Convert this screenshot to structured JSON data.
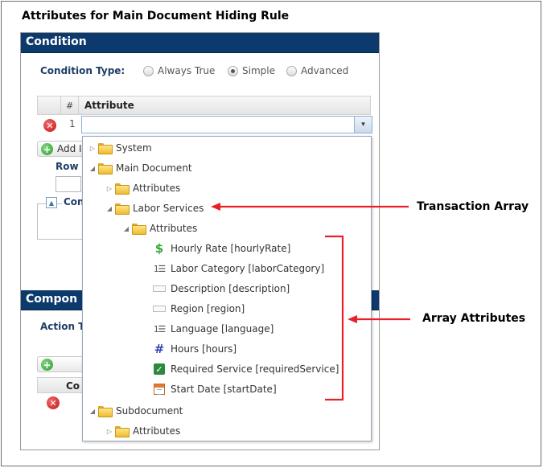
{
  "title": "Attributes for Main Document Hiding Rule",
  "condition_section": {
    "header": "Condition",
    "condition_type_label": "Condition Type:",
    "radios": [
      {
        "label": "Always True",
        "checked": false
      },
      {
        "label": "Simple",
        "checked": true
      },
      {
        "label": "Advanced",
        "checked": false
      }
    ],
    "grid": {
      "col_hash": "#",
      "col_attribute": "Attribute",
      "row_number": "1",
      "dropdown_arrow": "▾"
    },
    "add_button_label": "Add I",
    "row_label": "Row",
    "conditions_label": "Con"
  },
  "components_section": {
    "header": "Compon",
    "action_label": "Action T",
    "grid_col": "Co"
  },
  "tree": {
    "system": "System",
    "main_document": "Main Document",
    "md_attributes": "Attributes",
    "labor_services": "Labor Services",
    "ls_attributes": "Attributes",
    "items": [
      {
        "label": "Hourly Rate [hourlyRate]",
        "icon": "dollar-icon"
      },
      {
        "label": "Labor Category [laborCategory]",
        "icon": "list-icon"
      },
      {
        "label": "Description [description]",
        "icon": "text-field-icon"
      },
      {
        "label": "Region [region]",
        "icon": "text-field-icon"
      },
      {
        "label": "Language [language]",
        "icon": "list-icon"
      },
      {
        "label": "Hours [hours]",
        "icon": "number-icon"
      },
      {
        "label": "Required Service [requiredService]",
        "icon": "checkbox-icon"
      },
      {
        "label": "Start Date [startDate]",
        "icon": "calendar-icon"
      }
    ],
    "subdocument": "Subdocument",
    "sd_attributes": "Attributes"
  },
  "annotations": {
    "transaction_array": "Transaction Array",
    "array_attributes": "Array Attributes"
  },
  "colors": {
    "header_bg": "#0d3a6c",
    "annotation_red": "#e8202a"
  }
}
